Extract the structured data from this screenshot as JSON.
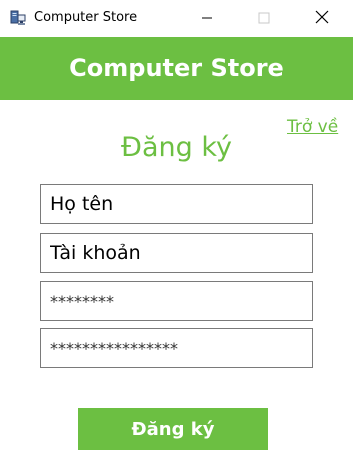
{
  "window": {
    "title": "Computer Store",
    "app_icon": "computer-icon",
    "controls": [
      "minimize-icon",
      "maximize-icon",
      "close-icon"
    ]
  },
  "banner": {
    "title": "Computer Store"
  },
  "back_link": {
    "label": "Trở về"
  },
  "form": {
    "title": "Đăng ký",
    "fields": [
      {
        "name": "full-name",
        "value": "Họ tên"
      },
      {
        "name": "username",
        "value": "Tài khoản"
      },
      {
        "name": "password",
        "value": "********"
      },
      {
        "name": "confirm-password",
        "value": "****************"
      }
    ],
    "submit_label": "Đăng ký"
  },
  "colors": {
    "accent": "#6cbf42",
    "banner_text": "#ffffff",
    "field_border": "#7a7a7a"
  }
}
